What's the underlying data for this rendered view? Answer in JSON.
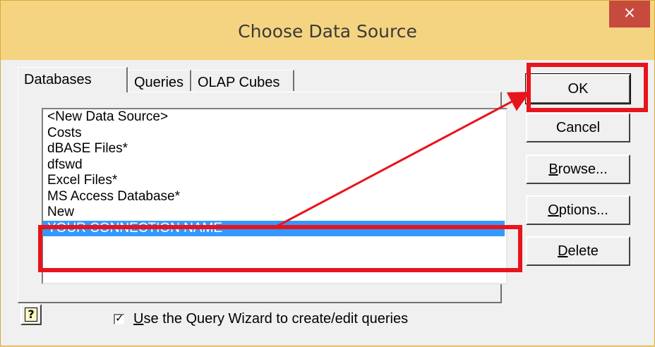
{
  "window": {
    "title": "Choose Data Source",
    "close_glyph": "×"
  },
  "tabs": [
    {
      "label": "Databases"
    },
    {
      "label": "Queries"
    },
    {
      "label": "OLAP Cubes"
    }
  ],
  "data_sources": {
    "items": [
      {
        "label": "<New Data Source>"
      },
      {
        "label": "Costs"
      },
      {
        "label": "dBASE Files*"
      },
      {
        "label": "dfswd"
      },
      {
        "label": "Excel Files*"
      },
      {
        "label": "MS Access Database*"
      },
      {
        "label": "New"
      },
      {
        "label": "YOUR CONNECTION NAME"
      }
    ],
    "selected": "YOUR CONNECTION NAME"
  },
  "buttons": {
    "ok": "OK",
    "cancel": "Cancel",
    "browse_mnemonic": "B",
    "browse_rest": "rowse...",
    "options_mnemonic": "O",
    "options_rest": "ptions...",
    "delete_mnemonic": "D",
    "delete_rest": "elete",
    "help_glyph": "?"
  },
  "query_wizard": {
    "checked": true,
    "label_mnemonic": "U",
    "label_rest": "se the Query Wizard to create/edit queries"
  },
  "annotation": {
    "color": "#e8141c"
  }
}
